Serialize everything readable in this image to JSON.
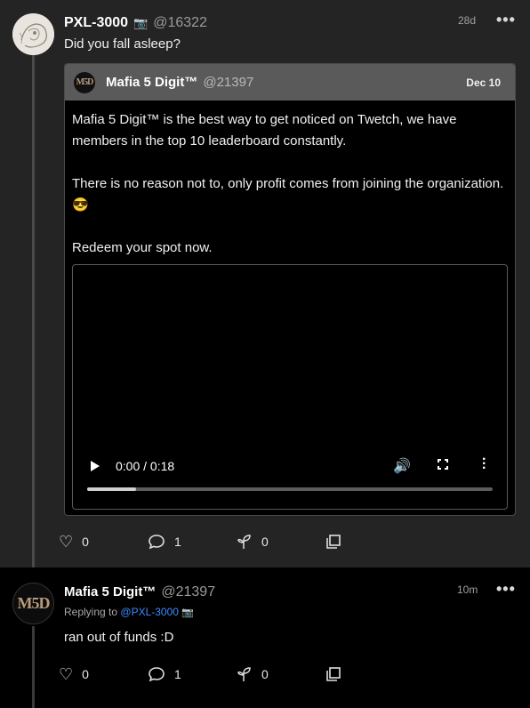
{
  "post1": {
    "author": "PXL-3000",
    "badge_icon": "camera-icon",
    "handle": "@16322",
    "time": "28d",
    "text": "Did you fall asleep?",
    "quote": {
      "author": "Mafia 5 Digit™",
      "handle": "@21397",
      "date": "Dec 10",
      "paragraphs": [
        "Mafia 5 Digit™ is the best way to get noticed on Twetch, we have members in the top 10 leaderboard constantly.",
        "There is no reason not to, only profit comes from joining the organization. 😎",
        "Redeem your spot now."
      ],
      "video": {
        "time": "0:00 / 0:18",
        "progress": 0.12
      }
    },
    "actions": {
      "likes": "0",
      "comments": "1",
      "branches": "0"
    }
  },
  "post2": {
    "author": "Mafia 5 Digit™",
    "handle": "@21397",
    "time": "10m",
    "replying_prefix": "Replying to",
    "replying_to": "@PXL-3000",
    "text": "ran out of funds :D",
    "actions": {
      "likes": "0",
      "comments": "1",
      "branches": "0"
    }
  },
  "avatar_logo": "M5D"
}
